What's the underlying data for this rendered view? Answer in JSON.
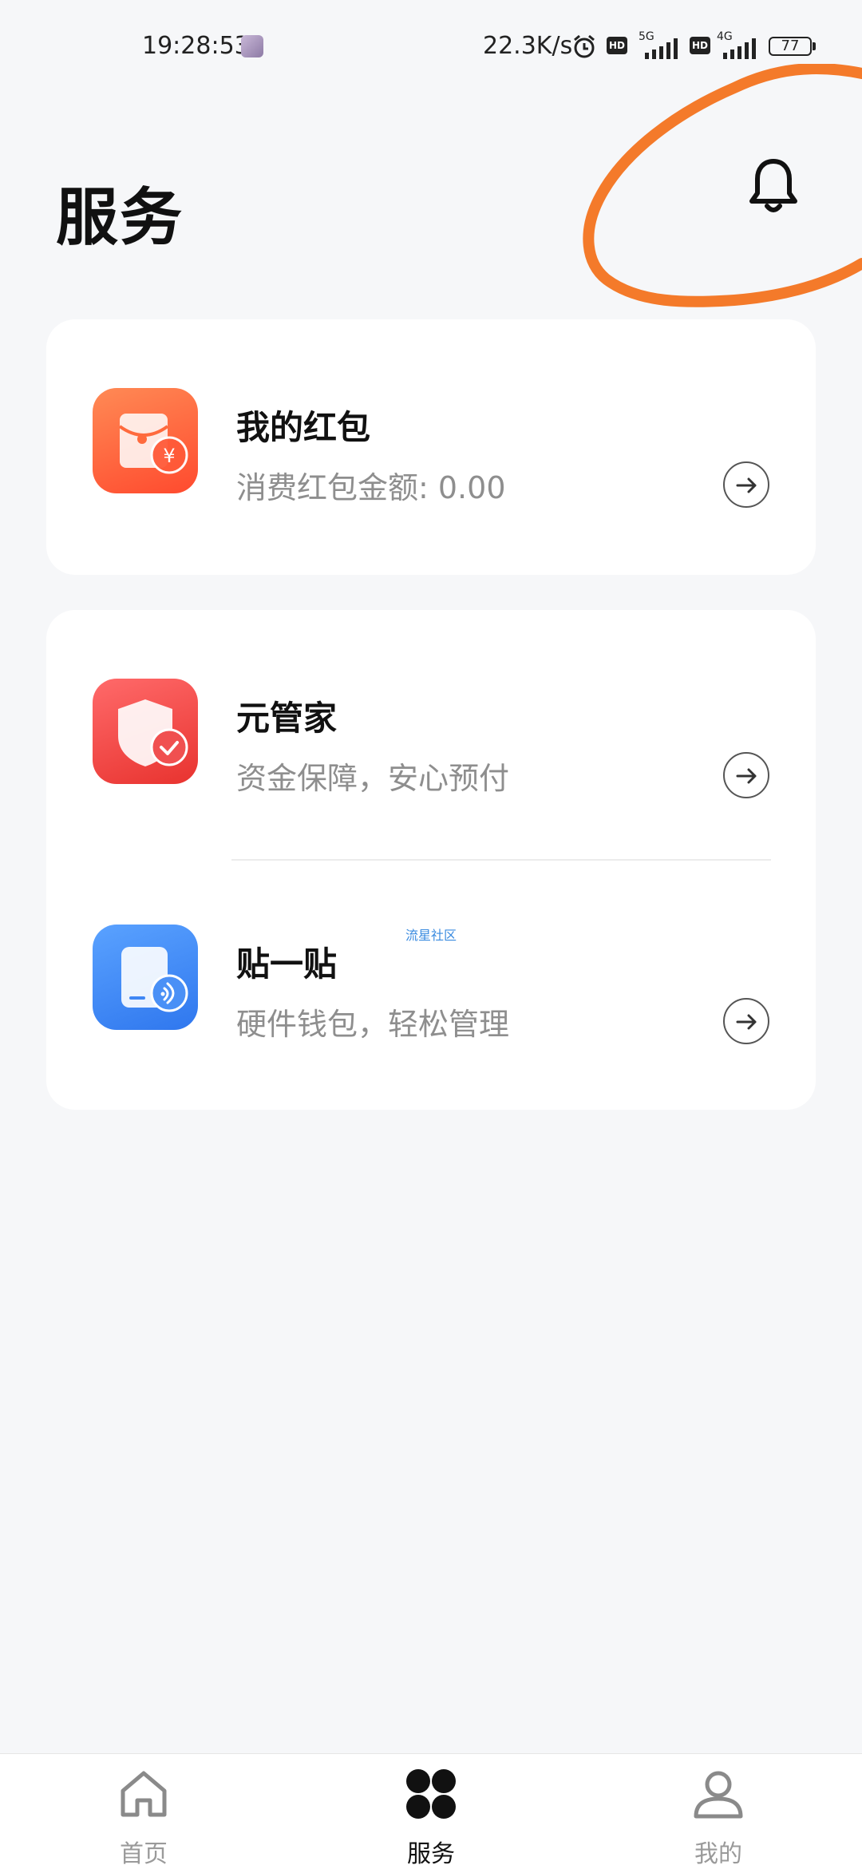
{
  "status_bar": {
    "time": "19:28:53",
    "net_speed": "22.3K/s",
    "net1": "5G",
    "net2": "4G",
    "hd": "HD",
    "battery": "77"
  },
  "header": {
    "title": "服务"
  },
  "cards": {
    "red_packet": {
      "title": "我的红包",
      "subtitle": "消费红包金额: 0.00"
    },
    "yuan_guanjia": {
      "title": "元管家",
      "subtitle": "资金保障，安心预付"
    },
    "tie_yi_tie": {
      "title": "贴一贴",
      "subtitle": "硬件钱包，轻松管理"
    }
  },
  "watermark": "流星社区",
  "bottom_nav": {
    "items": [
      {
        "label": "首页",
        "icon": "home-icon"
      },
      {
        "label": "服务",
        "icon": "grid-icon"
      },
      {
        "label": "我的",
        "icon": "person-icon"
      }
    ]
  },
  "colors": {
    "background": "#f6f7f9",
    "annotation_orange": "#f47a2a",
    "red_packet_icon": "#ff6a3d",
    "guanjia_icon": "#f24848",
    "tie_icon": "#3f86f4"
  }
}
